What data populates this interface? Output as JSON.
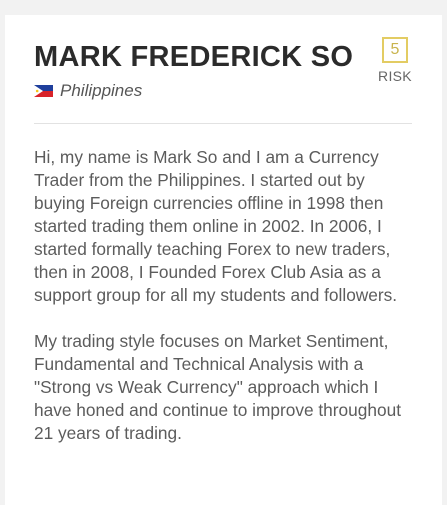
{
  "profile": {
    "name": "MARK FREDERICK SO",
    "country": "Philippines",
    "country_flag_icon": "philippines-flag-icon",
    "risk_value": "5",
    "risk_label": "RISK",
    "risk_color": "#e3cc63",
    "bio_paragraphs": [
      "Hi, my name is Mark So and I am a Currency Trader from the Philippines. I started out by buying Foreign currencies offline in 1998 then started trading them online in 2002. In 2006, I started formally teaching Forex to new traders, then in 2008, I Founded Forex Club Asia as a support group for all my students and followers.",
      "My trading style focuses on Market Sentiment, Fundamental and Technical Analysis with a \"Strong vs Weak Currency\" approach which I have honed and continue to improve throughout 21 years of trading."
    ]
  }
}
